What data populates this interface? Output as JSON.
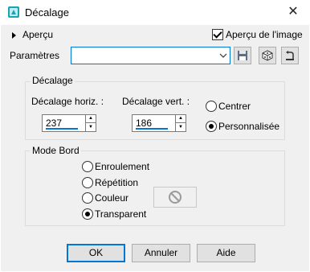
{
  "window": {
    "title": "Décalage",
    "close_glyph": "✕"
  },
  "preview": {
    "label": "Aperçu",
    "show_image_label": "Aperçu de l'image",
    "show_image_checked": true
  },
  "params": {
    "label": "Paramètres",
    "value": ""
  },
  "offset_group": {
    "title": "Décalage",
    "horiz_label": "Décalage horiz. :",
    "horiz_value": "237",
    "vert_label": "Décalage vert. :",
    "vert_value": "186",
    "center_label": "Centrer",
    "custom_label": "Personnalisée",
    "selected": "custom"
  },
  "edge_group": {
    "title": "Mode Bord",
    "options": [
      "Enroulement",
      "Répétition",
      "Couleur",
      "Transparent"
    ],
    "selected": "Transparent"
  },
  "buttons": {
    "ok": "OK",
    "cancel": "Annuler",
    "help": "Aide"
  },
  "colors": {
    "accent": "#0078d7",
    "dialog_bg": "#f0f0f0",
    "icon_teal": "#1aa3b8"
  }
}
